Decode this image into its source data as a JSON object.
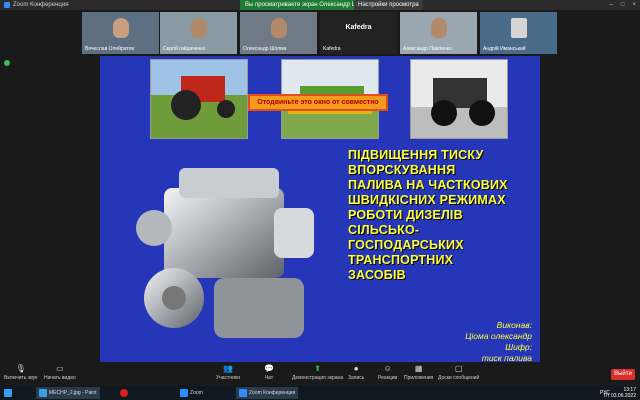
{
  "window": {
    "app_title": "Zoom Конференция",
    "viewing_banner": "Вы просматриваете экран Олександр Шолма",
    "view_options": "Настройки просмотра",
    "controls": [
      "–",
      "□",
      "×"
    ]
  },
  "participants": [
    {
      "name": "Вячеслав Олейратов"
    },
    {
      "name": "Сергій гайдаченко"
    },
    {
      "name": "Олександр Шолма"
    },
    {
      "name": "Kafedra",
      "big_label": "Kafedra"
    },
    {
      "name": "Александр Павленко"
    },
    {
      "name": "Андрій Иманський"
    }
  ],
  "slide": {
    "notice": "Отодвиньте это окно от совместно",
    "title": "ПІДВИЩЕННЯ ТИСКУ\nВПОРСКУВАННЯ\nПАЛИВА НА ЧАСТКОВИХ\nШВИДКІСНИХ РЕЖИМАХ\nРОБОТИ ДИЗЕЛІВ\nСІЛЬСЬКО-\nГОСПОДАРСЬКИХ\nТРАНСПОРТНИХ\nЗАСОБІВ",
    "author_line1": "Виконав:",
    "author_line2": "Ціома олександр",
    "author_line3": "Шифр:",
    "author_line4": "тиск палива"
  },
  "toolbar": {
    "audio": "Включить звук",
    "video": "Начать видео",
    "participants": "Участники",
    "participants_count": "6",
    "chat": "Чат",
    "share": "Демонстрация экрана",
    "record": "Запись",
    "reactions": "Реакции",
    "apps": "Приложения",
    "whiteboards": "Доски сообщений",
    "exit": "Выйти"
  },
  "taskbar": {
    "paint": "MECHP_2.jpg - Paint",
    "zoom": "Zoom",
    "zoom_conf": "Zoom Конференция",
    "lang": "РУС",
    "time": "13:17",
    "date": "Пт 03.06.2022"
  }
}
